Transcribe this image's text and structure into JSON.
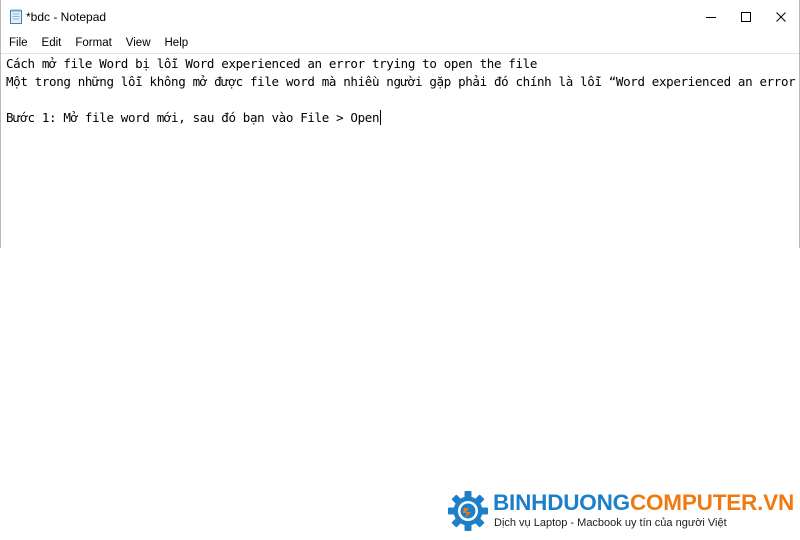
{
  "window": {
    "title": "*bdc - Notepad",
    "controls": {
      "minimize": "minimize",
      "maximize": "maximize",
      "close": "close"
    }
  },
  "menu": [
    {
      "label": "File"
    },
    {
      "label": "Edit"
    },
    {
      "label": "Format"
    },
    {
      "label": "View"
    },
    {
      "label": "Help"
    }
  ],
  "editor": {
    "lines": [
      "Cách mở file Word bị lỗi Word experienced an error trying to open the file",
      "Một trong những lỗi không mở được file word mà nhiều người gặp phải đó chính là lỗi “Word experienced an error trying to op",
      "",
      "Bước 1: Mở file word mới, sau đó bạn vào File > Open"
    ]
  },
  "watermark": {
    "brand_part1": "BINHDUONG",
    "brand_part2": "COMPUTER.VN",
    "tagline": "Dịch vụ Laptop - Macbook uy tín của người Việt",
    "colors": {
      "blue": "#1e7fc9",
      "orange": "#f07a12"
    }
  }
}
